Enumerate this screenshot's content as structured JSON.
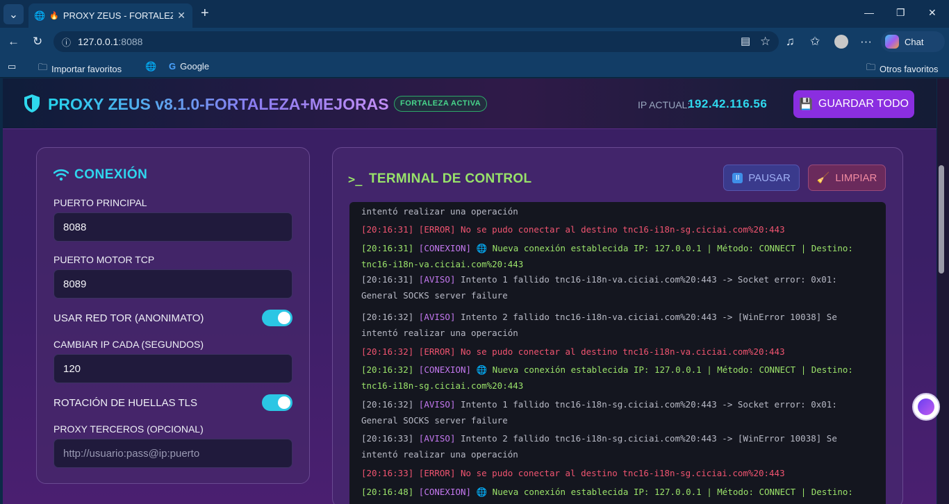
{
  "browser": {
    "tab_title": "PROXY ZEUS - FORTALEZA DE S",
    "url_host": "127.0.0.1",
    "url_port": ":8088",
    "favorites": {
      "import_label": "Importar favoritos",
      "google_label": "Google",
      "other_label": "Otros favoritos"
    },
    "chat_label": "Chat",
    "icons": [
      "tab-list-icon",
      "globe-icon",
      "fire-icon",
      "close-icon",
      "plus-icon",
      "minimize-icon",
      "restore-icon",
      "close-window-icon",
      "back-icon",
      "reload-icon",
      "info-icon",
      "reader-icon",
      "star-icon",
      "music-icon",
      "favorites-icon",
      "profile-icon",
      "more-icon",
      "copilot-icon"
    ]
  },
  "header": {
    "title": "PROXY ZEUS v8.1.0-FORTALEZA+MEJORAS",
    "badge": "FORTALEZA ACTIVA",
    "ip_label": "IP ACTUAL:",
    "ip_value": "192.42.116.56",
    "save_label": "GUARDAR TODO",
    "colors": {
      "accent": "#2fd9ee",
      "save": "#8a2ee0",
      "badge": "#47d68b"
    }
  },
  "connection": {
    "title": "CONEXIÓN",
    "main_port_label": "PUERTO PRINCIPAL",
    "main_port_value": "8088",
    "tcp_port_label": "PUERTO MOTOR TCP",
    "tcp_port_value": "8089",
    "tor_label": "USAR RED TOR (ANONIMATO)",
    "tor_enabled": true,
    "ip_interval_label": "CAMBIAR IP CADA (SEGUNDOS)",
    "ip_interval_value": "120",
    "tls_label": "ROTACIÓN DE HUELLAS TLS",
    "tls_enabled": true,
    "proxy_label": "PROXY TERCEROS (OPCIONAL)",
    "proxy_placeholder": "http://usuario:pass@ip:puerto"
  },
  "terminal": {
    "prompt": ">_",
    "title": "TERMINAL DE CONTROL",
    "pause_label": "PAUSAR",
    "clear_label": "LIMPIAR",
    "logs": [
      {
        "time": "",
        "tag": "",
        "kind": "av",
        "text": "intentó realizar una operación"
      },
      {
        "time": "[20:16:31]",
        "tag": "[ERROR]",
        "kind": "err",
        "text": "No se pudo conectar al destino tnc16-i18n-sg.ciciai.com%20:443"
      },
      {
        "time": "[20:16:31]",
        "tag": "[CONEXION]",
        "kind": "ok",
        "text": "🌐 Nueva conexión establecida IP: 127.0.0.1 | Método: CONNECT | Destino: tnc16-i18n-va.ciciai.com%20:443"
      },
      {
        "time": "[20:16:31]",
        "tag": "[AVISO]",
        "kind": "av",
        "text": "Intento 1 fallido tnc16-i18n-va.ciciai.com%20:443 -> Socket error: 0x01: General SOCKS server failure"
      },
      {
        "time": "[20:16:32]",
        "tag": "[AVISO]",
        "kind": "av",
        "text": "Intento 2 fallido tnc16-i18n-va.ciciai.com%20:443 -> [WinError 10038] Se intentó realizar una operación"
      },
      {
        "time": "[20:16:32]",
        "tag": "[ERROR]",
        "kind": "err",
        "text": "No se pudo conectar al destino tnc16-i18n-va.ciciai.com%20:443"
      },
      {
        "time": "[20:16:32]",
        "tag": "[CONEXION]",
        "kind": "ok",
        "text": "🌐 Nueva conexión establecida IP: 127.0.0.1 | Método: CONNECT | Destino: tnc16-i18n-sg.ciciai.com%20:443"
      },
      {
        "time": "[20:16:32]",
        "tag": "[AVISO]",
        "kind": "av",
        "text": "Intento 1 fallido tnc16-i18n-sg.ciciai.com%20:443 -> Socket error: 0x01: General SOCKS server failure"
      },
      {
        "time": "[20:16:33]",
        "tag": "[AVISO]",
        "kind": "av",
        "text": "Intento 2 fallido tnc16-i18n-sg.ciciai.com%20:443 -> [WinError 10038] Se intentó realizar una operación"
      },
      {
        "time": "[20:16:33]",
        "tag": "[ERROR]",
        "kind": "err",
        "text": "No se pudo conectar al destino tnc16-i18n-sg.ciciai.com%20:443"
      },
      {
        "time": "[20:16:48]",
        "tag": "[CONEXION]",
        "kind": "ok",
        "text": "🌐 Nueva conexión establecida IP: 127.0.0.1 | Método: CONNECT | Destino:"
      }
    ]
  }
}
